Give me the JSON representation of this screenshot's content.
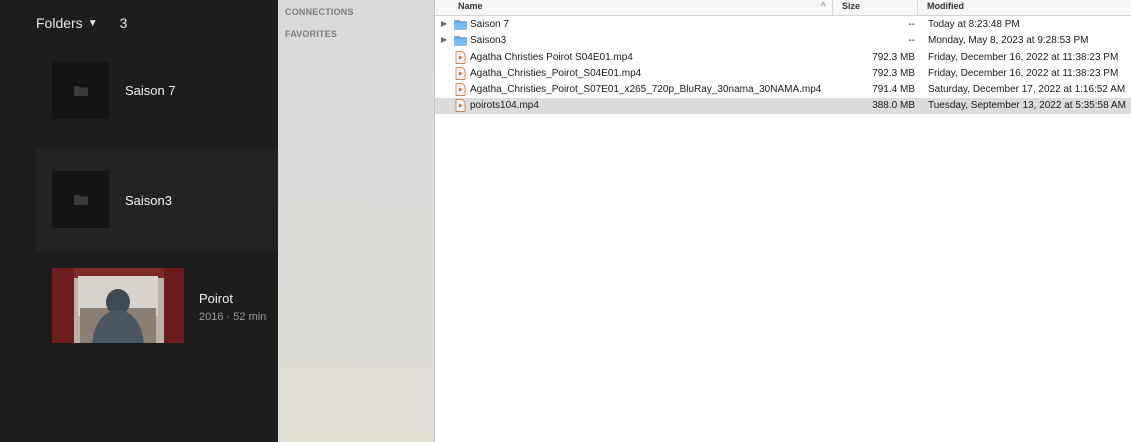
{
  "media_app": {
    "folders_label": "Folders",
    "folders_count": "3",
    "items": [
      {
        "title": "Saison 7",
        "icon": "folder-icon"
      },
      {
        "title": "Saison3",
        "icon": "folder-icon"
      },
      {
        "title": "Poirot",
        "meta": "2016 · 52 min"
      }
    ]
  },
  "sidebar": {
    "connections_label": "CONNECTIONS",
    "favorites_label": "FAVORITES"
  },
  "file_list": {
    "columns": {
      "name": "Name",
      "size": "Size",
      "modified": "Modified"
    },
    "rows": [
      {
        "type": "folder",
        "name": "Saison 7",
        "size": "--",
        "modified": "Today at 8:23:48 PM"
      },
      {
        "type": "folder",
        "name": "Saison3",
        "size": "--",
        "modified": "Monday, May 8, 2023 at 9:28:53 PM"
      },
      {
        "type": "file",
        "name": "Agatha Christies Poirot S04E01.mp4",
        "size": "792.3 MB",
        "modified": "Friday, December 16, 2022 at 11:38:23 PM"
      },
      {
        "type": "file",
        "name": "Agatha_Christies_Poirot_S04E01.mp4",
        "size": "792.3 MB",
        "modified": "Friday, December 16, 2022 at 11:38:23 PM"
      },
      {
        "type": "file",
        "name": "Agatha_Christies_Poirot_S07E01_x265_720p_BluRay_30nama_30NAMA.mp4",
        "size": "791.4 MB",
        "modified": "Saturday, December 17, 2022 at 1:16:52 AM"
      },
      {
        "type": "file",
        "name": "poirots104.mp4",
        "size": "388.0 MB",
        "modified": "Tuesday, September 13, 2022 at 5:35:58 AM"
      }
    ]
  },
  "colors": {
    "folder_blue": "#5fa8e8",
    "selection_gray": "#dcdcdc",
    "media_bg": "#1d1d1d"
  }
}
